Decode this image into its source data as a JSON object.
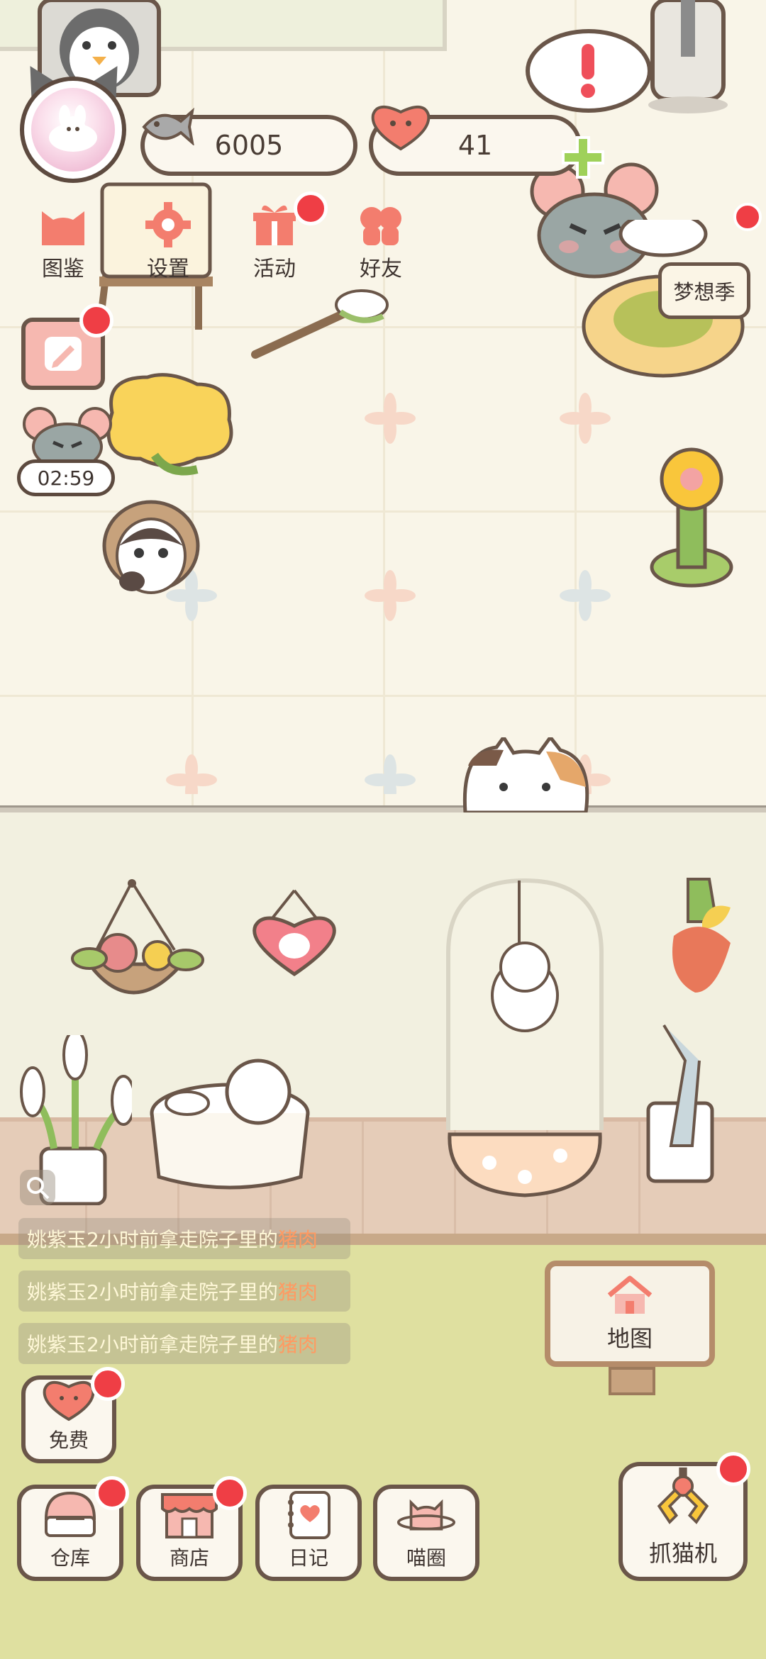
{
  "currency": {
    "fish_coins": "6005",
    "hearts": "41"
  },
  "menu": {
    "items": [
      {
        "label": "图鉴",
        "icon": "cat-head-icon"
      },
      {
        "label": "设置",
        "icon": "gear-icon"
      },
      {
        "label": "活动",
        "icon": "gift-icon"
      },
      {
        "label": "好友",
        "icon": "friends-icon"
      }
    ]
  },
  "event": {
    "dream_season_label": "梦想季"
  },
  "timer": {
    "value": "02:59"
  },
  "feed": {
    "messages": [
      {
        "prefix": "姚紫玉2小时前拿走院子里的",
        "item": "猪肉"
      },
      {
        "prefix": "姚紫玉2小时前拿走院子里的",
        "item": "猪肉"
      },
      {
        "prefix": "姚紫玉2小时前拿走院子里的",
        "item": "猪肉"
      }
    ]
  },
  "map": {
    "label": "地图"
  },
  "bottom": {
    "free_label": "免费",
    "warehouse_label": "仓库",
    "shop_label": "商店",
    "diary_label": "日记",
    "community_label": "喵圈",
    "claw_label": "抓猫机"
  },
  "colors": {
    "notification": "#ef3e45",
    "accent_pink": "#f37d6e",
    "border_brown": "#6a5649"
  }
}
